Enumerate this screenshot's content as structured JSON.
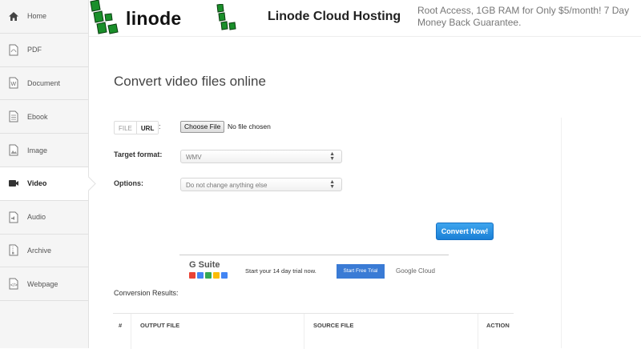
{
  "sidebar": {
    "items": [
      {
        "label": "Home",
        "icon": "home-icon"
      },
      {
        "label": "PDF",
        "icon": "pdf-icon"
      },
      {
        "label": "Document",
        "icon": "document-icon"
      },
      {
        "label": "Ebook",
        "icon": "ebook-icon"
      },
      {
        "label": "Image",
        "icon": "image-icon"
      },
      {
        "label": "Video",
        "icon": "video-icon",
        "active": true
      },
      {
        "label": "Audio",
        "icon": "audio-icon"
      },
      {
        "label": "Archive",
        "icon": "archive-icon"
      },
      {
        "label": "Webpage",
        "icon": "webpage-icon"
      }
    ]
  },
  "ad": {
    "brand": "linode",
    "title": "Linode Cloud Hosting",
    "description": "Root Access, 1GB RAM for Only $5/month! 7 Day Money Back Guarantee.",
    "brand_color": "#0f7a1c"
  },
  "main": {
    "title": "Convert video files online",
    "source_tabs": {
      "file": "FILE",
      "url": "URL",
      "colon": ":"
    },
    "choose_file_label": "Choose File",
    "file_status": "No file chosen",
    "target_format_label": "Target format:",
    "target_format_value": "WMV",
    "options_label": "Options:",
    "options_value": "Do not change anything else",
    "convert_label": "Convert Now!",
    "accent_color": "#1a7fd6"
  },
  "google_ad": {
    "brand": "G Suite",
    "text": "Start your 14 day trial now.",
    "cta": "Start Free Trial",
    "partner": "Google Cloud"
  },
  "results": {
    "label": "Conversion Results:",
    "columns": [
      "#",
      "OUTPUT FILE",
      "SOURCE FILE",
      "ACTION"
    ]
  }
}
